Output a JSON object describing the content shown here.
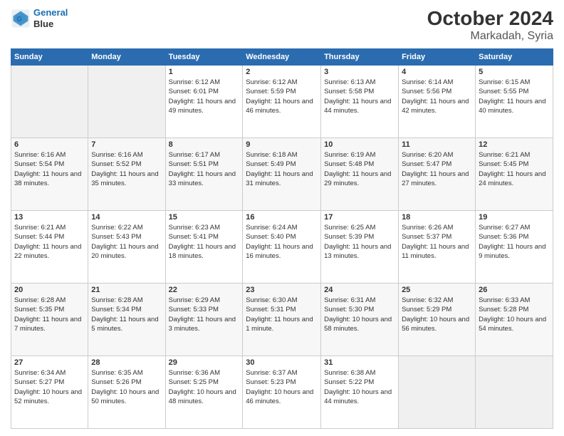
{
  "header": {
    "logo_line1": "General",
    "logo_line2": "Blue",
    "month": "October 2024",
    "location": "Markadah, Syria"
  },
  "days_of_week": [
    "Sunday",
    "Monday",
    "Tuesday",
    "Wednesday",
    "Thursday",
    "Friday",
    "Saturday"
  ],
  "weeks": [
    [
      {
        "day": "",
        "info": ""
      },
      {
        "day": "",
        "info": ""
      },
      {
        "day": "1",
        "info": "Sunrise: 6:12 AM\nSunset: 6:01 PM\nDaylight: 11 hours and 49 minutes."
      },
      {
        "day": "2",
        "info": "Sunrise: 6:12 AM\nSunset: 5:59 PM\nDaylight: 11 hours and 46 minutes."
      },
      {
        "day": "3",
        "info": "Sunrise: 6:13 AM\nSunset: 5:58 PM\nDaylight: 11 hours and 44 minutes."
      },
      {
        "day": "4",
        "info": "Sunrise: 6:14 AM\nSunset: 5:56 PM\nDaylight: 11 hours and 42 minutes."
      },
      {
        "day": "5",
        "info": "Sunrise: 6:15 AM\nSunset: 5:55 PM\nDaylight: 11 hours and 40 minutes."
      }
    ],
    [
      {
        "day": "6",
        "info": "Sunrise: 6:16 AM\nSunset: 5:54 PM\nDaylight: 11 hours and 38 minutes."
      },
      {
        "day": "7",
        "info": "Sunrise: 6:16 AM\nSunset: 5:52 PM\nDaylight: 11 hours and 35 minutes."
      },
      {
        "day": "8",
        "info": "Sunrise: 6:17 AM\nSunset: 5:51 PM\nDaylight: 11 hours and 33 minutes."
      },
      {
        "day": "9",
        "info": "Sunrise: 6:18 AM\nSunset: 5:49 PM\nDaylight: 11 hours and 31 minutes."
      },
      {
        "day": "10",
        "info": "Sunrise: 6:19 AM\nSunset: 5:48 PM\nDaylight: 11 hours and 29 minutes."
      },
      {
        "day": "11",
        "info": "Sunrise: 6:20 AM\nSunset: 5:47 PM\nDaylight: 11 hours and 27 minutes."
      },
      {
        "day": "12",
        "info": "Sunrise: 6:21 AM\nSunset: 5:45 PM\nDaylight: 11 hours and 24 minutes."
      }
    ],
    [
      {
        "day": "13",
        "info": "Sunrise: 6:21 AM\nSunset: 5:44 PM\nDaylight: 11 hours and 22 minutes."
      },
      {
        "day": "14",
        "info": "Sunrise: 6:22 AM\nSunset: 5:43 PM\nDaylight: 11 hours and 20 minutes."
      },
      {
        "day": "15",
        "info": "Sunrise: 6:23 AM\nSunset: 5:41 PM\nDaylight: 11 hours and 18 minutes."
      },
      {
        "day": "16",
        "info": "Sunrise: 6:24 AM\nSunset: 5:40 PM\nDaylight: 11 hours and 16 minutes."
      },
      {
        "day": "17",
        "info": "Sunrise: 6:25 AM\nSunset: 5:39 PM\nDaylight: 11 hours and 13 minutes."
      },
      {
        "day": "18",
        "info": "Sunrise: 6:26 AM\nSunset: 5:37 PM\nDaylight: 11 hours and 11 minutes."
      },
      {
        "day": "19",
        "info": "Sunrise: 6:27 AM\nSunset: 5:36 PM\nDaylight: 11 hours and 9 minutes."
      }
    ],
    [
      {
        "day": "20",
        "info": "Sunrise: 6:28 AM\nSunset: 5:35 PM\nDaylight: 11 hours and 7 minutes."
      },
      {
        "day": "21",
        "info": "Sunrise: 6:28 AM\nSunset: 5:34 PM\nDaylight: 11 hours and 5 minutes."
      },
      {
        "day": "22",
        "info": "Sunrise: 6:29 AM\nSunset: 5:33 PM\nDaylight: 11 hours and 3 minutes."
      },
      {
        "day": "23",
        "info": "Sunrise: 6:30 AM\nSunset: 5:31 PM\nDaylight: 11 hours and 1 minute."
      },
      {
        "day": "24",
        "info": "Sunrise: 6:31 AM\nSunset: 5:30 PM\nDaylight: 10 hours and 58 minutes."
      },
      {
        "day": "25",
        "info": "Sunrise: 6:32 AM\nSunset: 5:29 PM\nDaylight: 10 hours and 56 minutes."
      },
      {
        "day": "26",
        "info": "Sunrise: 6:33 AM\nSunset: 5:28 PM\nDaylight: 10 hours and 54 minutes."
      }
    ],
    [
      {
        "day": "27",
        "info": "Sunrise: 6:34 AM\nSunset: 5:27 PM\nDaylight: 10 hours and 52 minutes."
      },
      {
        "day": "28",
        "info": "Sunrise: 6:35 AM\nSunset: 5:26 PM\nDaylight: 10 hours and 50 minutes."
      },
      {
        "day": "29",
        "info": "Sunrise: 6:36 AM\nSunset: 5:25 PM\nDaylight: 10 hours and 48 minutes."
      },
      {
        "day": "30",
        "info": "Sunrise: 6:37 AM\nSunset: 5:23 PM\nDaylight: 10 hours and 46 minutes."
      },
      {
        "day": "31",
        "info": "Sunrise: 6:38 AM\nSunset: 5:22 PM\nDaylight: 10 hours and 44 minutes."
      },
      {
        "day": "",
        "info": ""
      },
      {
        "day": "",
        "info": ""
      }
    ]
  ]
}
